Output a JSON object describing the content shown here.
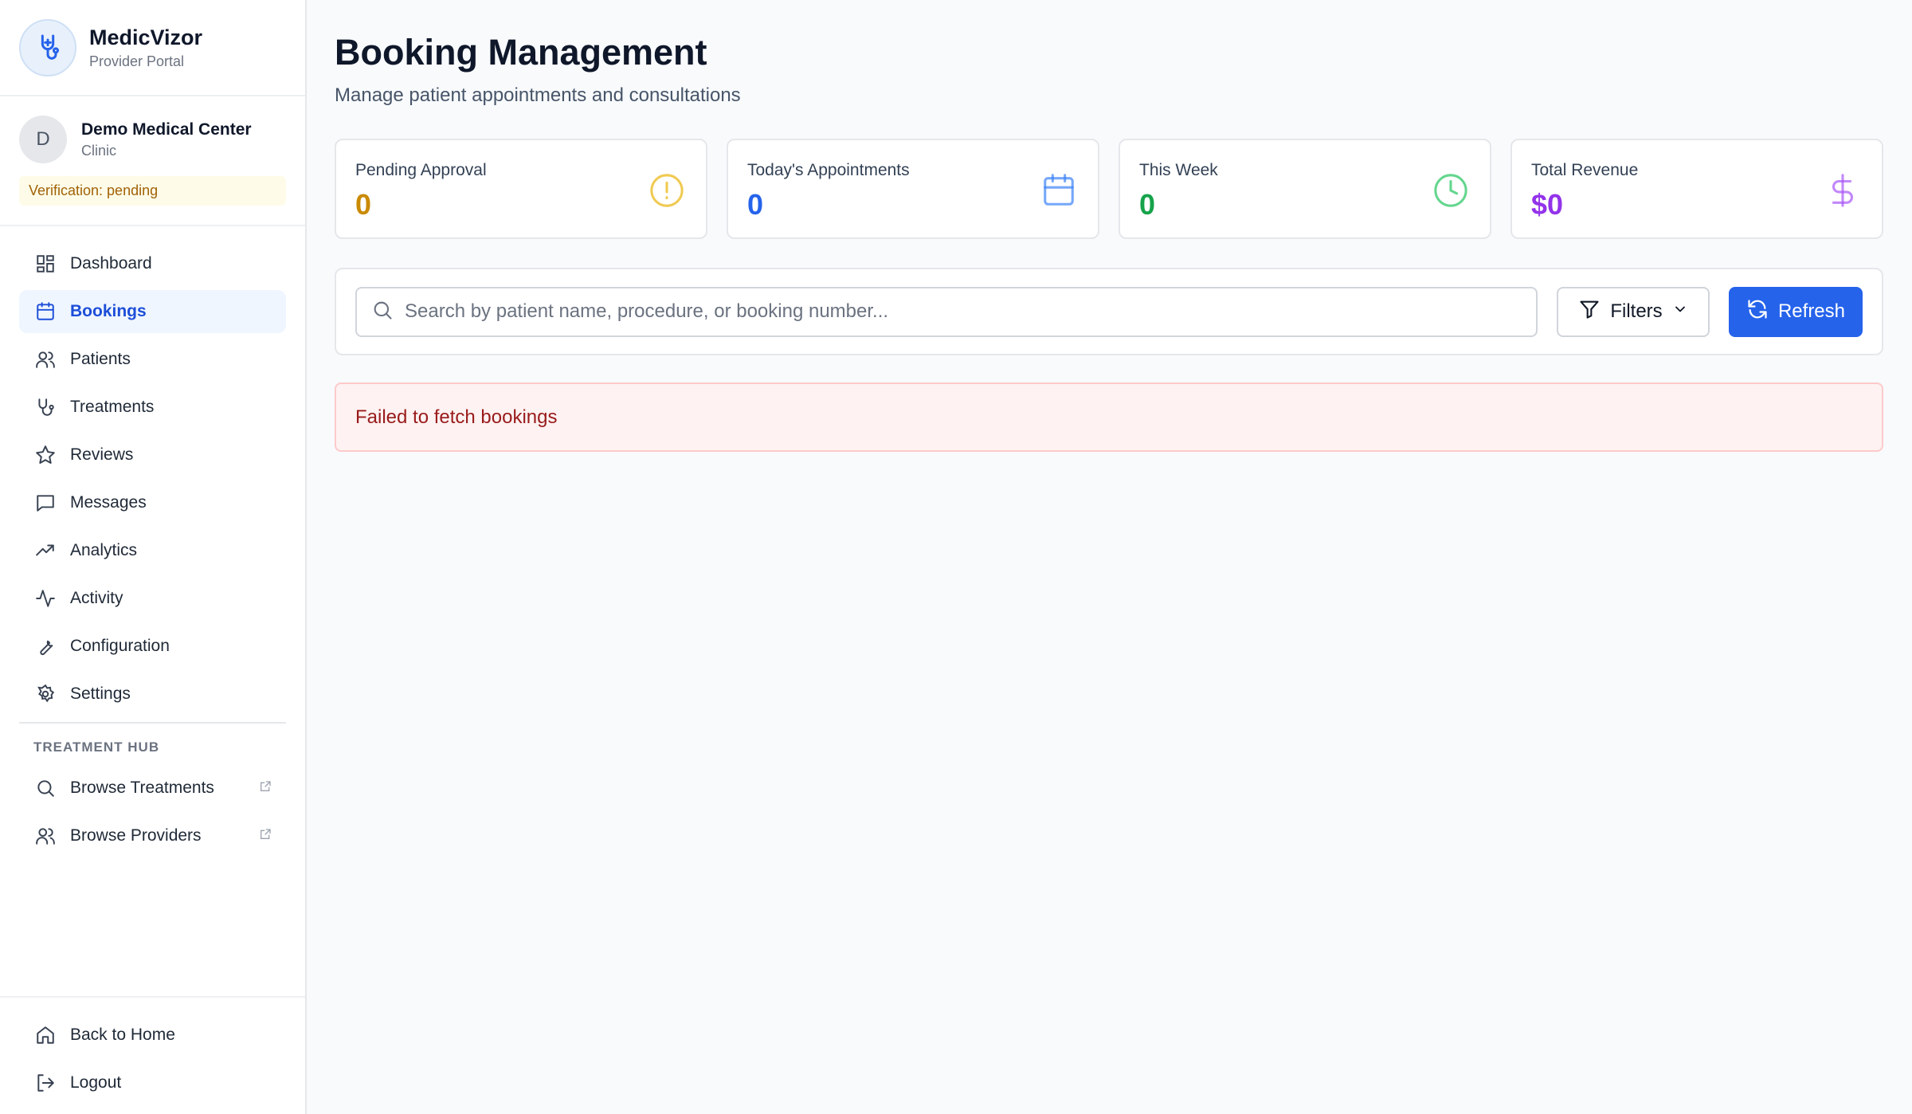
{
  "brand": {
    "name": "MedicVizor",
    "subtitle": "Provider Portal"
  },
  "org": {
    "initial": "D",
    "name": "Demo Medical Center",
    "type": "Clinic",
    "verification": "Verification: pending"
  },
  "nav": {
    "items": [
      {
        "label": "Dashboard",
        "icon": "grid-icon"
      },
      {
        "label": "Bookings",
        "icon": "calendar-icon"
      },
      {
        "label": "Patients",
        "icon": "users-icon"
      },
      {
        "label": "Treatments",
        "icon": "stethoscope-icon"
      },
      {
        "label": "Reviews",
        "icon": "star-icon"
      },
      {
        "label": "Messages",
        "icon": "message-icon"
      },
      {
        "label": "Analytics",
        "icon": "trending-up-icon"
      },
      {
        "label": "Activity",
        "icon": "activity-icon"
      },
      {
        "label": "Configuration",
        "icon": "wrench-icon"
      },
      {
        "label": "Settings",
        "icon": "gear-icon"
      }
    ],
    "hub_label": "TREATMENT HUB",
    "hub_items": [
      {
        "label": "Browse Treatments",
        "icon": "search-icon"
      },
      {
        "label": "Browse Providers",
        "icon": "users-icon"
      }
    ],
    "bottom_items": [
      {
        "label": "Back to Home",
        "icon": "home-icon"
      },
      {
        "label": "Logout",
        "icon": "logout-icon"
      }
    ]
  },
  "page": {
    "title": "Booking Management",
    "subtitle": "Manage patient appointments and consultations"
  },
  "stats": [
    {
      "label": "Pending Approval",
      "value": "0",
      "color": "#ca8a04"
    },
    {
      "label": "Today's Appointments",
      "value": "0",
      "color": "#2563eb"
    },
    {
      "label": "This Week",
      "value": "0",
      "color": "#16a34a"
    },
    {
      "label": "Total Revenue",
      "value": "$0",
      "color": "#9333ea"
    }
  ],
  "toolbar": {
    "search_placeholder": "Search by patient name, procedure, or booking number...",
    "filters_label": "Filters",
    "refresh_label": "Refresh"
  },
  "error": {
    "message": "Failed to fetch bookings"
  }
}
